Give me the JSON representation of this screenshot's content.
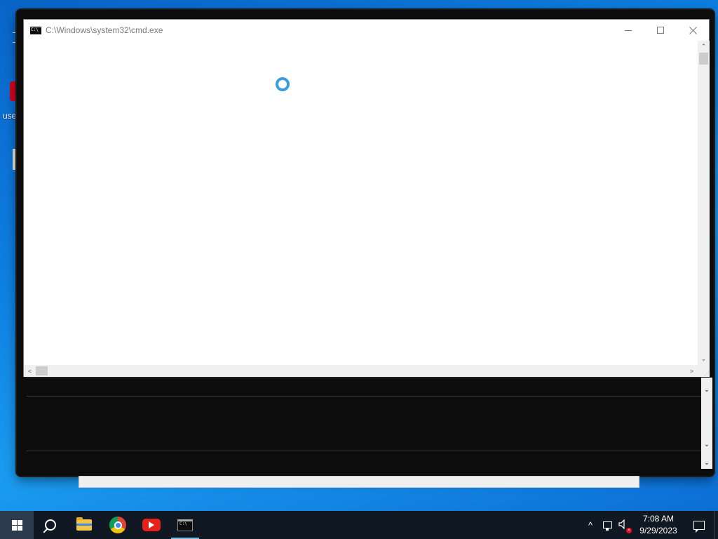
{
  "desktop": {
    "icon_label": "use"
  },
  "cmd_window": {
    "title": "C:\\Windows\\system32\\cmd.exe",
    "icon": "console-icon",
    "controls": [
      "minimize-icon",
      "maximize-icon",
      "close-icon"
    ],
    "state": "loading",
    "accent_color": "#3a9de0"
  },
  "taskbar": {
    "pinned": [
      {
        "name": "start",
        "icon": "windows-icon"
      },
      {
        "name": "search",
        "icon": "search-icon"
      },
      {
        "name": "file-explorer",
        "icon": "folder-icon"
      },
      {
        "name": "chrome",
        "icon": "chrome-icon"
      },
      {
        "name": "youtube",
        "icon": "youtube-icon"
      },
      {
        "name": "command-prompt",
        "icon": "console-icon",
        "active": true
      }
    ],
    "tray": {
      "chevron": "^",
      "time": "7:08 AM",
      "date": "9/29/2023"
    }
  },
  "colors": {
    "taskbar_bg": "#101823",
    "desktop_blue": "#0d7fe0",
    "console_bg": "#0c0c0c"
  }
}
